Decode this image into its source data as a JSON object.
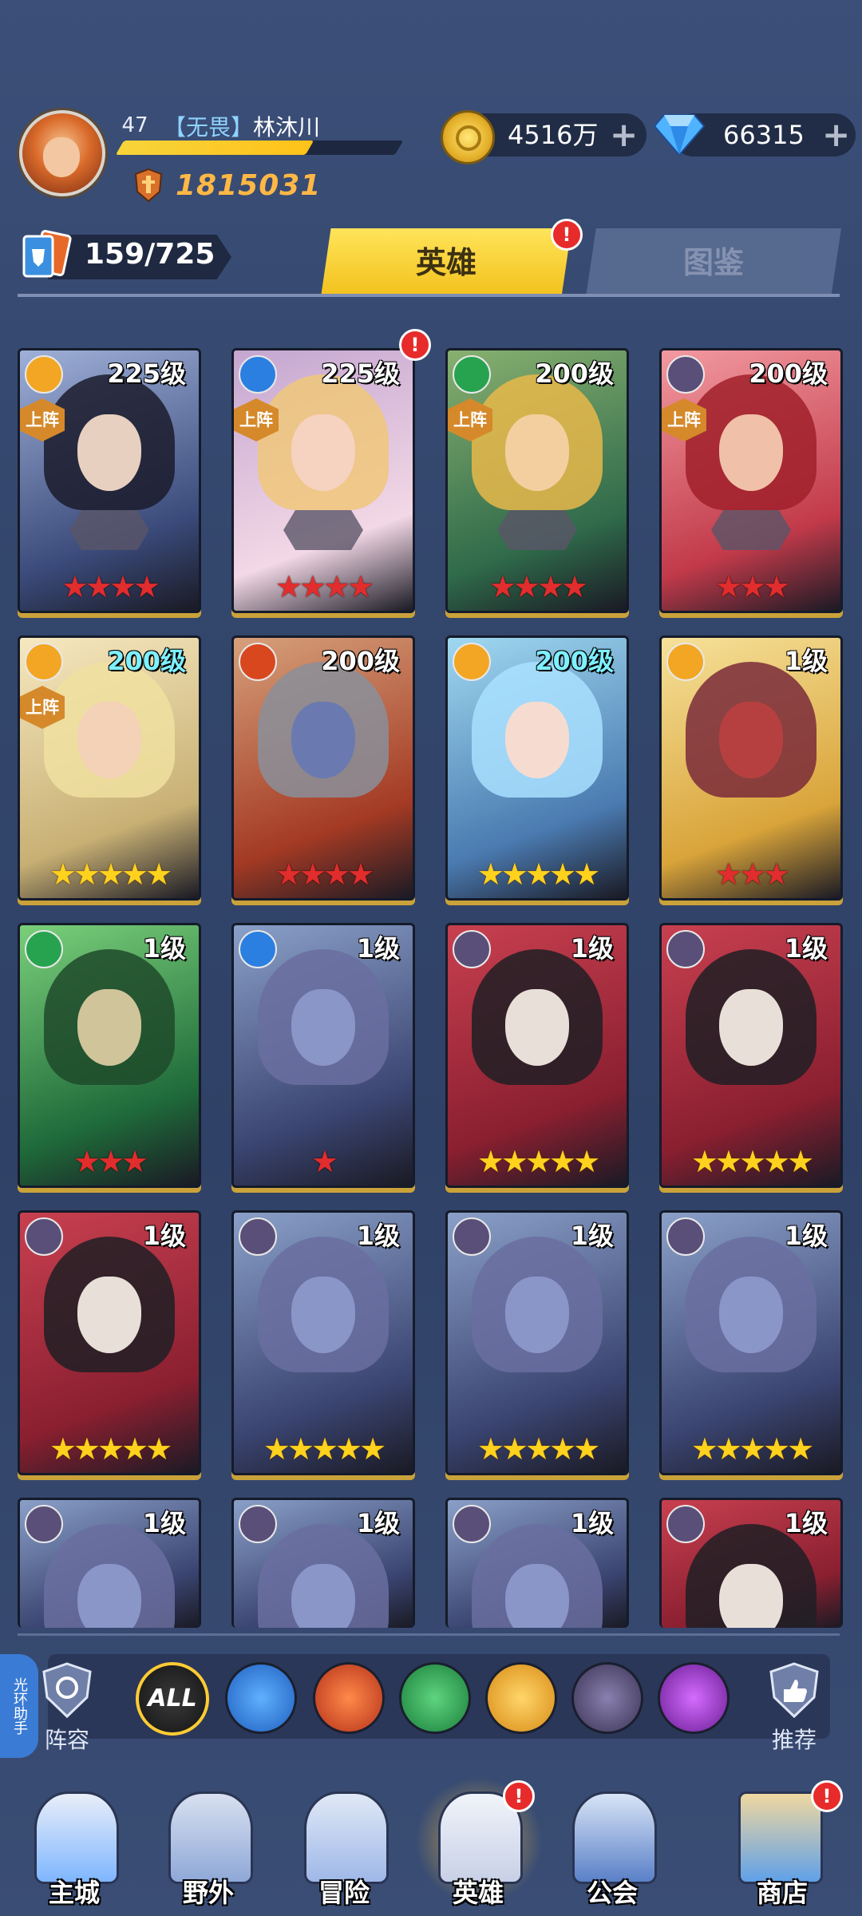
{
  "player": {
    "level": "47",
    "guild_tag": "【无畏】",
    "name": "林沐川",
    "xp_fraction": 0.68,
    "power": "1815031"
  },
  "resources": {
    "gold": "4516万",
    "gems": "66315",
    "plus": "+"
  },
  "collection": {
    "count": "159/725"
  },
  "tabs": {
    "heroes": "英雄",
    "codex": "图鉴",
    "notif": "!"
  },
  "badges": {
    "deployed": "上阵",
    "alert": "!"
  },
  "heroes": [
    {
      "level": "225级",
      "element": "light",
      "deployed": true,
      "stars": 4,
      "star_color": "red",
      "alert": false
    },
    {
      "level": "225级",
      "element": "water",
      "deployed": true,
      "stars": 4,
      "star_color": "red",
      "alert": true
    },
    {
      "level": "200级",
      "element": "wind",
      "deployed": true,
      "stars": 4,
      "star_color": "red",
      "alert": false
    },
    {
      "level": "200级",
      "element": "dark",
      "deployed": true,
      "stars": 3,
      "star_color": "red",
      "alert": false
    },
    {
      "level": "200级",
      "element": "light",
      "deployed": true,
      "stars": 5,
      "star_color": "gold",
      "alert": false,
      "level_color": "teal"
    },
    {
      "level": "200级",
      "element": "fire",
      "deployed": false,
      "stars": 4,
      "star_color": "red",
      "alert": false
    },
    {
      "level": "200级",
      "element": "light",
      "deployed": false,
      "stars": 5,
      "star_color": "gold",
      "alert": false,
      "level_color": "teal"
    },
    {
      "level": "1级",
      "element": "light",
      "deployed": false,
      "stars": 3,
      "star_color": "red",
      "alert": false
    },
    {
      "level": "1级",
      "element": "wind",
      "deployed": false,
      "stars": 3,
      "star_color": "red",
      "alert": false
    },
    {
      "level": "1级",
      "element": "water",
      "deployed": false,
      "stars": 1,
      "star_color": "red",
      "alert": false
    },
    {
      "level": "1级",
      "element": "dark",
      "deployed": false,
      "stars": 5,
      "star_color": "gold",
      "alert": false
    },
    {
      "level": "1级",
      "element": "dark",
      "deployed": false,
      "stars": 5,
      "star_color": "gold",
      "alert": false
    },
    {
      "level": "1级",
      "element": "dark",
      "deployed": false,
      "stars": 5,
      "star_color": "gold",
      "alert": false
    },
    {
      "level": "1级",
      "element": "dark",
      "deployed": false,
      "stars": 5,
      "star_color": "gold",
      "alert": false
    },
    {
      "level": "1级",
      "element": "dark",
      "deployed": false,
      "stars": 5,
      "star_color": "gold",
      "alert": false
    },
    {
      "level": "1级",
      "element": "dark",
      "deployed": false,
      "stars": 5,
      "star_color": "gold",
      "alert": false
    },
    {
      "level": "1级",
      "element": "dark",
      "deployed": false,
      "stars": 0,
      "star_color": "gold",
      "alert": false
    },
    {
      "level": "1级",
      "element": "dark",
      "deployed": false,
      "stars": 0,
      "star_color": "gold",
      "alert": false
    },
    {
      "level": "1级",
      "element": "dark",
      "deployed": false,
      "stars": 0,
      "star_color": "gold",
      "alert": false
    },
    {
      "level": "1级",
      "element": "dark",
      "deployed": false,
      "stars": 0,
      "star_color": "gold",
      "alert": false
    }
  ],
  "element_colors": {
    "light": "#f2a623",
    "water": "#2b7fe0",
    "wind": "#27a350",
    "dark": "#5a4f78",
    "fire": "#d9471f",
    "chaos": "#9b3bc4"
  },
  "filters": {
    "lineup": "阵容",
    "all": "ALL",
    "recommend": "推荐",
    "helper": "光环助手",
    "items": [
      "all",
      "water",
      "fire",
      "wind",
      "light",
      "dark",
      "chaos"
    ]
  },
  "nav": {
    "items": [
      "主城",
      "野外",
      "冒险",
      "英雄",
      "公会",
      "商店"
    ],
    "active_index": 3,
    "alerts": [
      false,
      false,
      false,
      true,
      false,
      true
    ]
  }
}
